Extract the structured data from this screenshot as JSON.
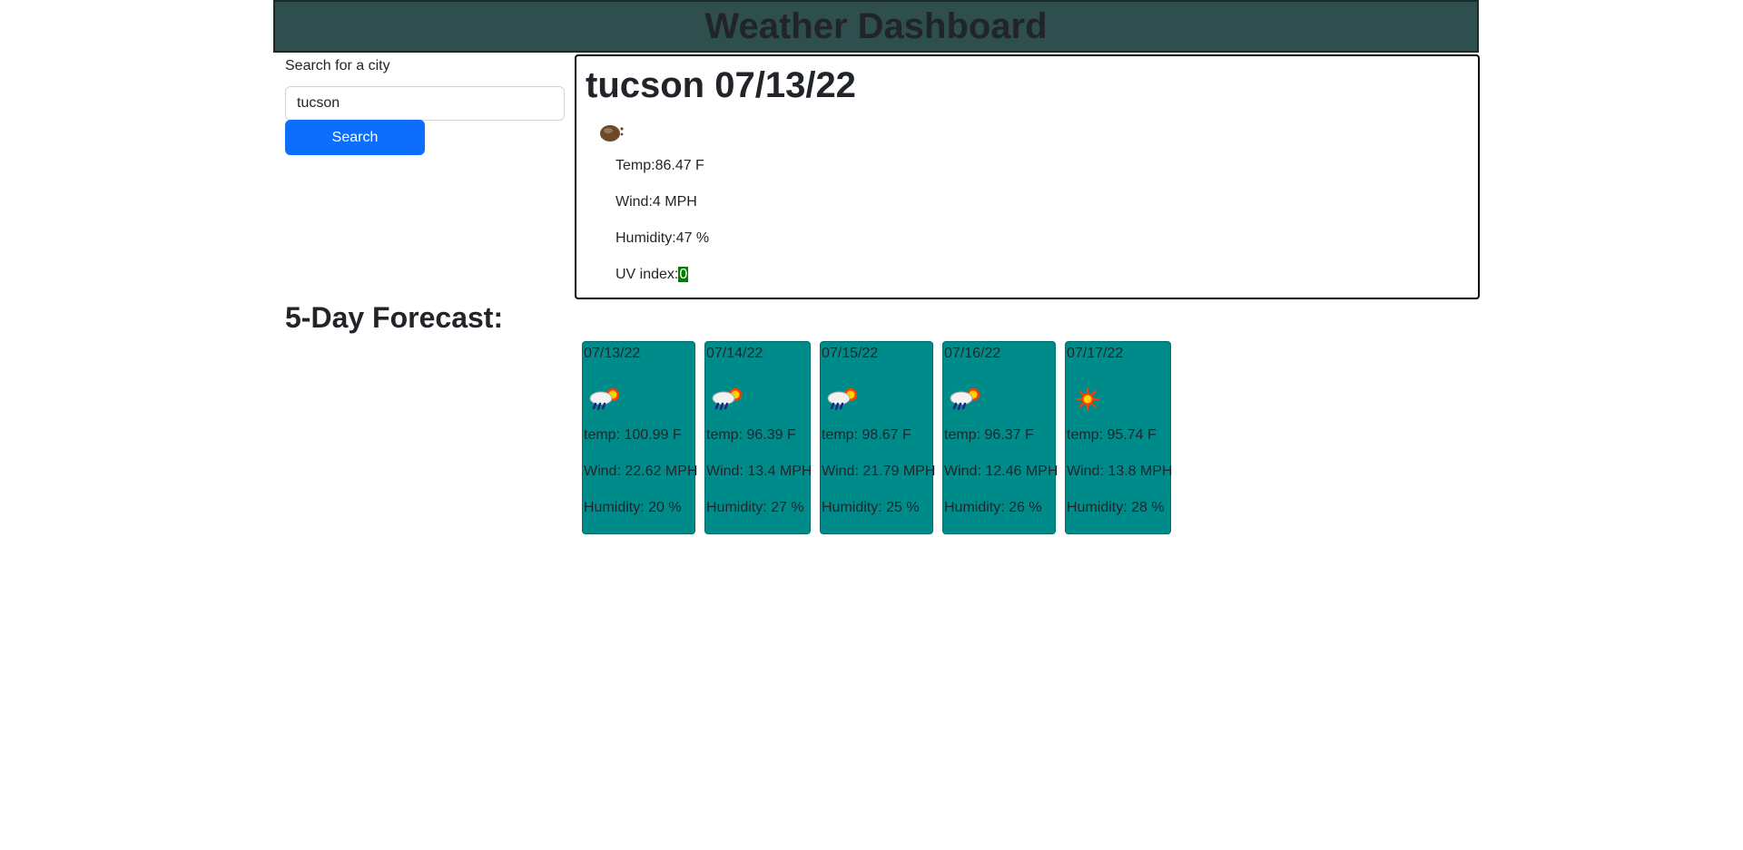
{
  "header": {
    "title": "Weather Dashboard"
  },
  "search": {
    "label": "Search for a city",
    "value": "tucson",
    "button_label": "Search"
  },
  "current": {
    "title": "tucson 07/13/22",
    "icon": "night-cloud-icon",
    "temp": "Temp:86.47 F",
    "wind": "Wind:4 MPH",
    "humidity": "Humidity:47 %",
    "uv_label": "UV index:",
    "uv_value": "0",
    "uv_color": "#008000"
  },
  "forecast": {
    "title": "5-Day Forecast:",
    "card_color": "#008b8b",
    "days": [
      {
        "date": "07/13/22",
        "icon": "rain-sun-icon",
        "temp": "temp: 100.99 F",
        "wind": "Wind: 22.62 MPH",
        "humidity": "Humidity: 20 %"
      },
      {
        "date": "07/14/22",
        "icon": "rain-sun-icon",
        "temp": "temp: 96.39 F",
        "wind": "Wind: 13.4 MPH",
        "humidity": "Humidity: 27 %"
      },
      {
        "date": "07/15/22",
        "icon": "rain-sun-icon",
        "temp": "temp: 98.67 F",
        "wind": "Wind: 21.79 MPH",
        "humidity": "Humidity: 25 %"
      },
      {
        "date": "07/16/22",
        "icon": "rain-sun-icon",
        "temp": "temp: 96.37 F",
        "wind": "Wind: 12.46 MPH",
        "humidity": "Humidity: 26 %"
      },
      {
        "date": "07/17/22",
        "icon": "sun-icon",
        "temp": "temp: 95.74 F",
        "wind": "Wind: 13.8 MPH",
        "humidity": "Humidity: 28 %"
      }
    ]
  }
}
